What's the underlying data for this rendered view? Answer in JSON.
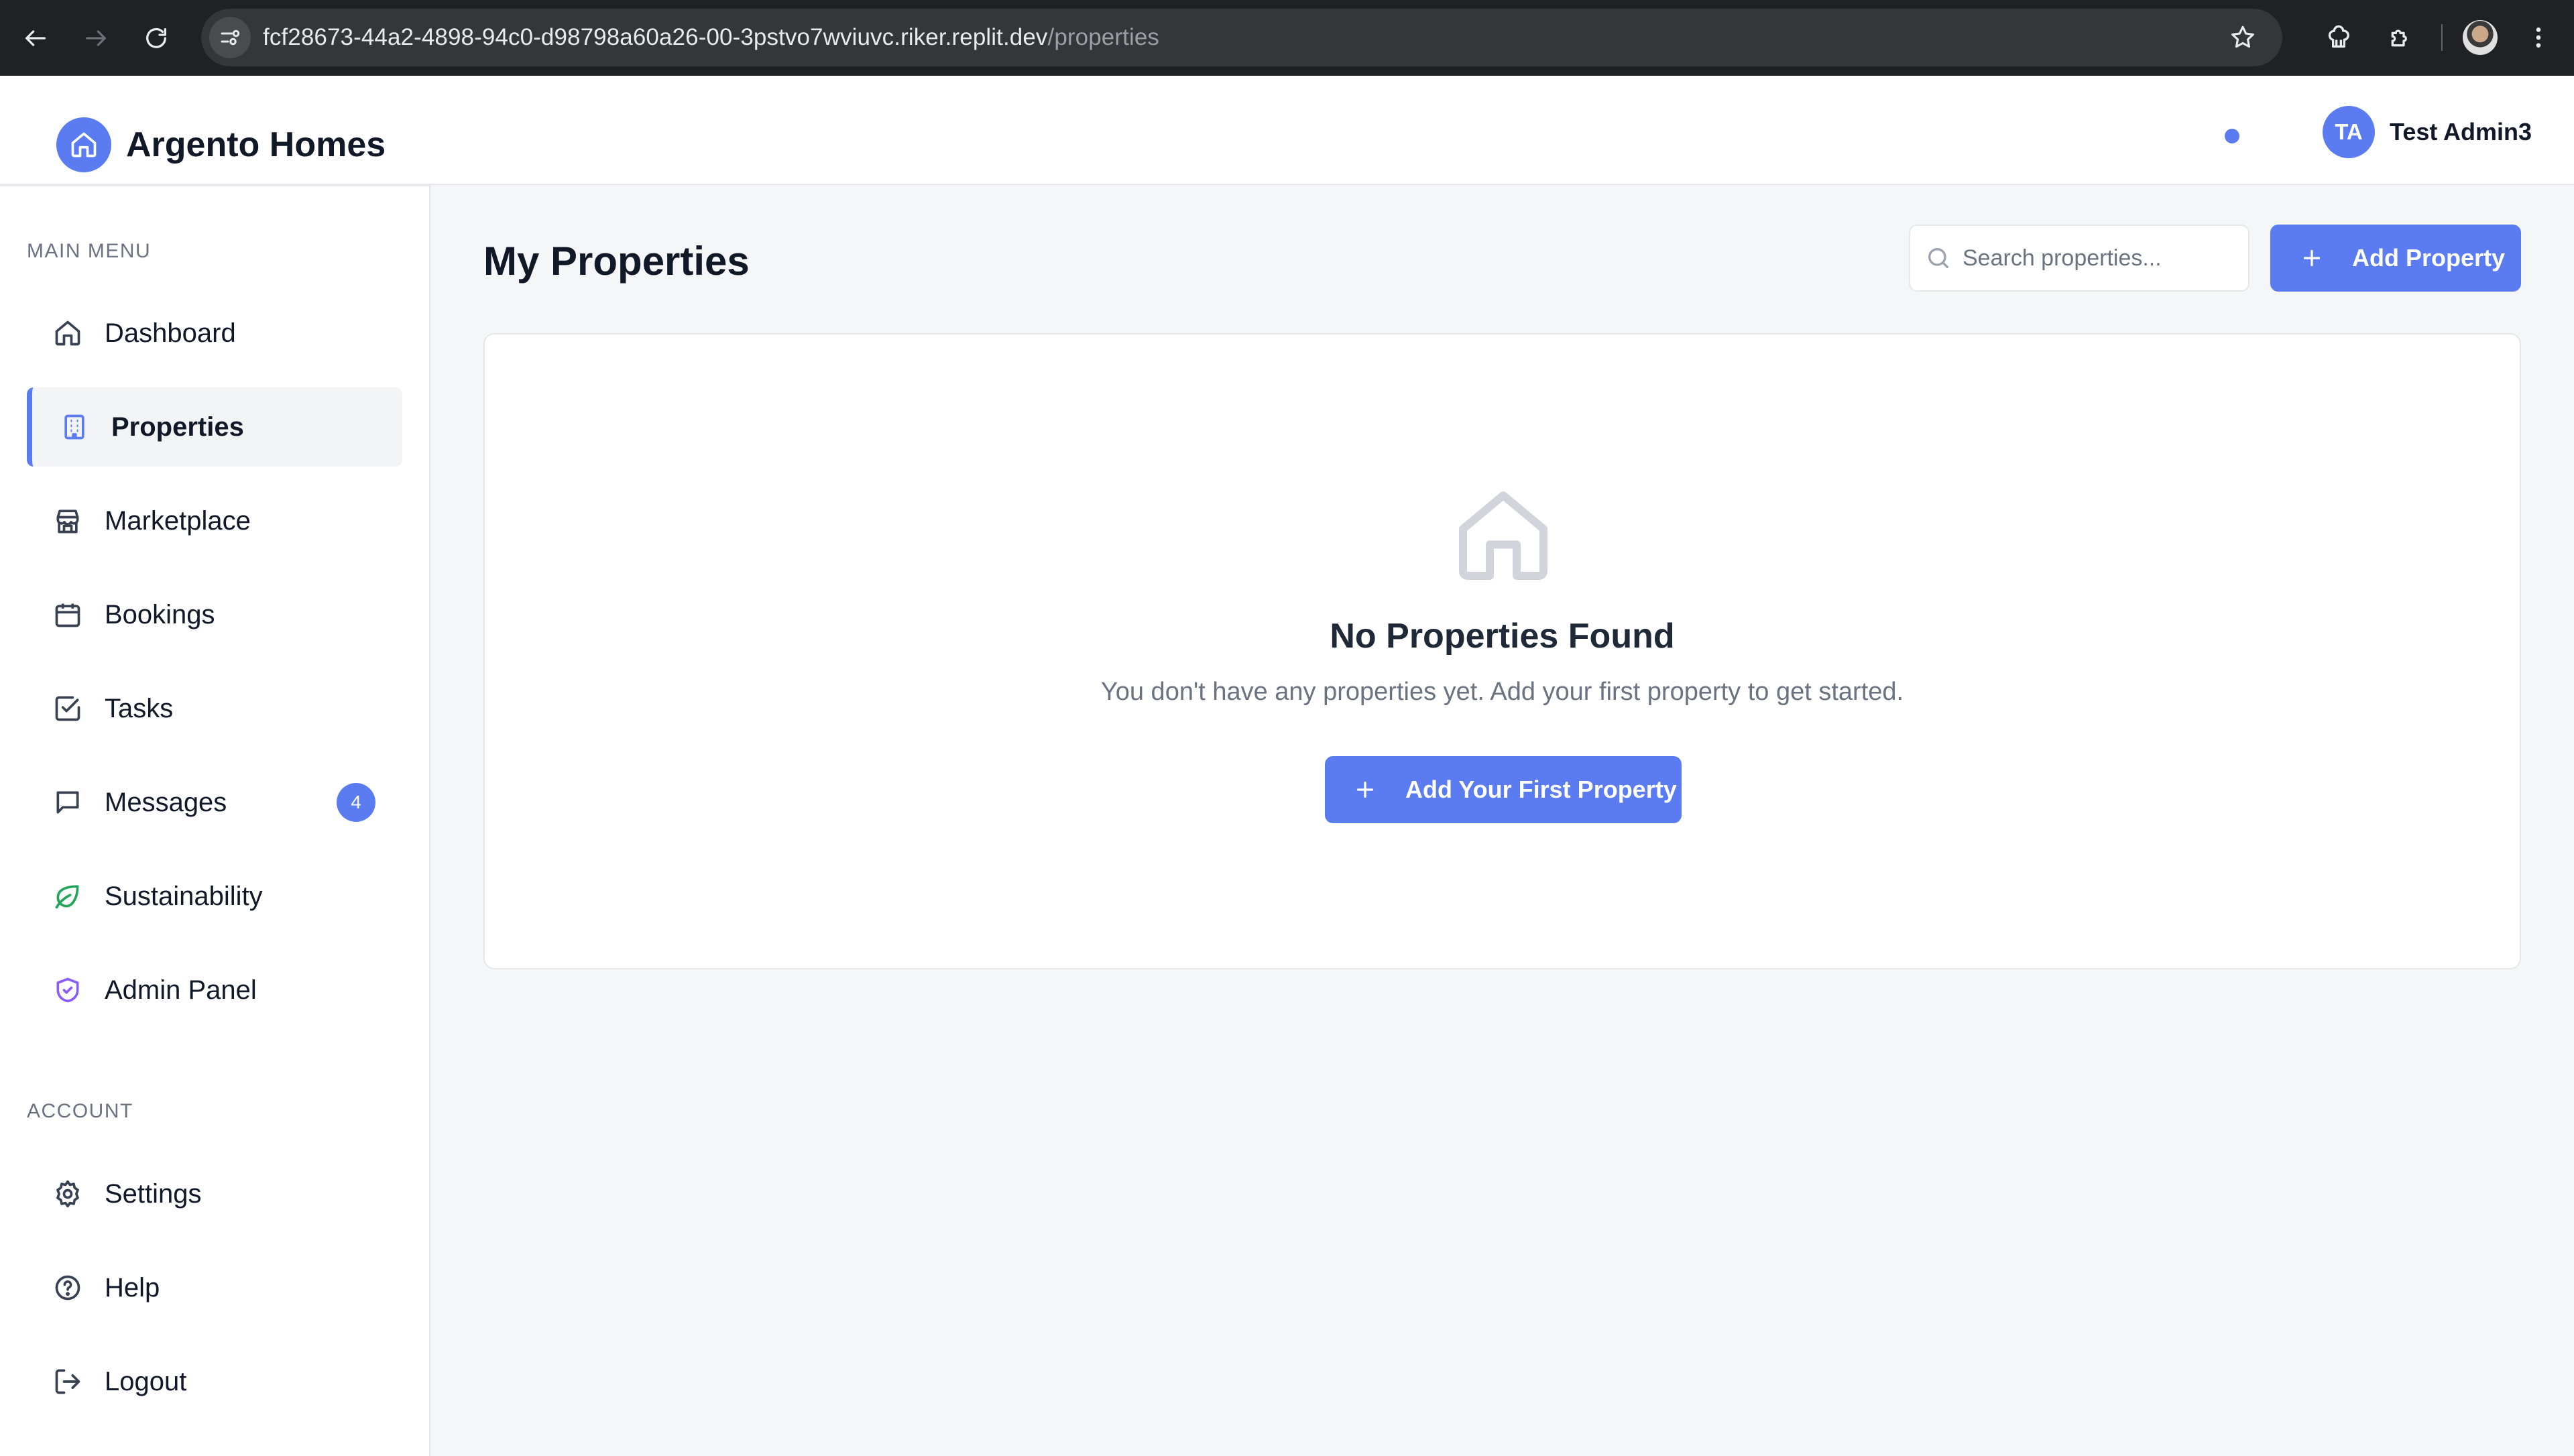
{
  "browser": {
    "url_host": "fcf28673-44a2-4898-94c0-d98798a60a26-00-3pstvo7wviuvc.riker.replit.dev",
    "url_path": "/properties"
  },
  "header": {
    "brand_name": "Argento Homes",
    "user_initials": "TA",
    "user_name": "Test Admin3"
  },
  "sidebar": {
    "main_label": "MAIN MENU",
    "account_label": "ACCOUNT",
    "items": [
      {
        "label": "Dashboard",
        "icon": "home-icon"
      },
      {
        "label": "Properties",
        "icon": "building-icon",
        "active": true
      },
      {
        "label": "Marketplace",
        "icon": "store-icon"
      },
      {
        "label": "Bookings",
        "icon": "calendar-icon"
      },
      {
        "label": "Tasks",
        "icon": "check-square-icon"
      },
      {
        "label": "Messages",
        "icon": "message-icon",
        "badge": "4"
      },
      {
        "label": "Sustainability",
        "icon": "leaf-icon",
        "color": "#22a559"
      },
      {
        "label": "Admin Panel",
        "icon": "shield-icon",
        "color": "#8b5cf6"
      }
    ],
    "account_items": [
      {
        "label": "Settings",
        "icon": "gear-icon"
      },
      {
        "label": "Help",
        "icon": "help-circle-icon"
      },
      {
        "label": "Logout",
        "icon": "logout-icon"
      }
    ]
  },
  "main": {
    "title": "My Properties",
    "search_placeholder": "Search properties...",
    "add_button": "Add Property",
    "empty_title": "No Properties Found",
    "empty_desc": "You don't have any properties yet. Add your first property to get started.",
    "empty_button": "Add Your First Property"
  },
  "colors": {
    "accent": "#5b7cf0",
    "background": "#f5f6f8"
  }
}
